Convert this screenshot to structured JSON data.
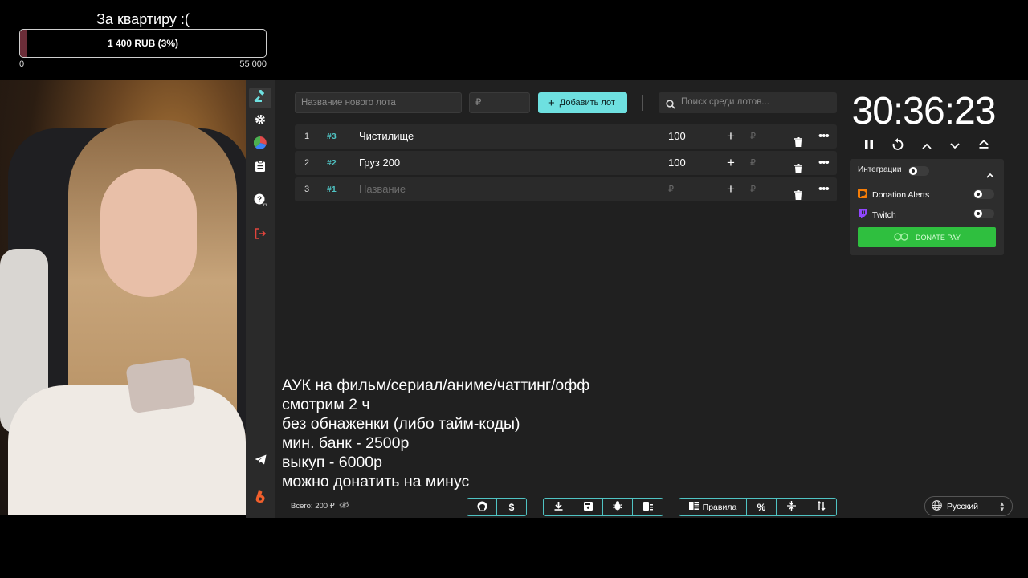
{
  "goal": {
    "title": "За квартиру :(",
    "bar_text": "1 400 RUB (3%)",
    "progress_fraction": 0.03,
    "fill_color": "#6b2d38",
    "min_label": "0",
    "max_label": "55 000"
  },
  "sidebar": {
    "items": [
      {
        "icon": "gavel-icon",
        "active": true
      },
      {
        "icon": "gear-icon"
      },
      {
        "icon": "pie-chart-icon"
      },
      {
        "icon": "clipboard-icon"
      },
      {
        "icon": "help-icon"
      },
      {
        "icon": "logout-icon"
      },
      {
        "icon": "telegram-icon"
      },
      {
        "icon": "boosty-icon"
      }
    ]
  },
  "toolbar": {
    "new_lot_placeholder": "Название нового лота",
    "amount_placeholder": "₽",
    "add_lot_label": "Добавить лот",
    "search_placeholder": "Поиск среди лотов..."
  },
  "lots": [
    {
      "index": "1",
      "tag": "#3",
      "name": "Чистилище",
      "amount": "100",
      "rub": "₽"
    },
    {
      "index": "2",
      "tag": "#2",
      "name": "Груз 200",
      "amount": "100",
      "rub": "₽"
    },
    {
      "index": "3",
      "tag": "#1",
      "name": "Название",
      "amount": "₽",
      "rub": "₽",
      "placeholder": true
    }
  ],
  "timer": {
    "value": "30:36:23"
  },
  "integrations": {
    "title": "Интеграции",
    "items": [
      {
        "name": "Donation Alerts",
        "icon": "donationalerts-icon",
        "color": "#f57d07"
      },
      {
        "name": "Twitch",
        "icon": "twitch-icon",
        "color": "#9146ff"
      }
    ],
    "donate_pay_label": "DONATE PAY"
  },
  "overlay_text": [
    "АУК на фильм/сериал/аниме/чаттинг/офф",
    "смотрим 2 ч",
    "без обнаженки (либо тайм-коды)",
    "мин. банк - 2500р",
    "выкуп - 6000р",
    "можно донатить на минус"
  ],
  "footer": {
    "total_label": "Всего: 200 ₽",
    "rules_label": "Правила",
    "language": "Русский"
  },
  "colors": {
    "accent": "#6ee0e0",
    "background": "#202020",
    "donate_pay": "#2fbf3f",
    "logout": "#e0443c"
  }
}
